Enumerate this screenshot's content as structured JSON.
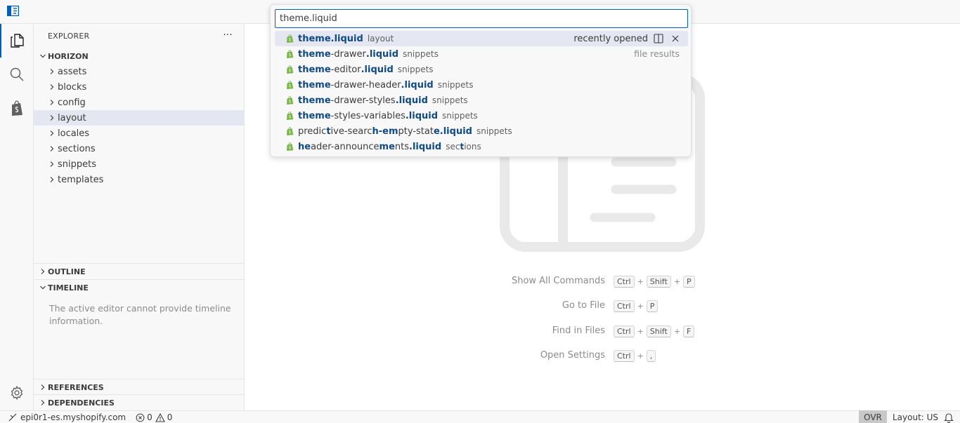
{
  "explorer": {
    "title": "EXPLORER",
    "more_label": "···",
    "workspace": "HORIZON",
    "folders": [
      "assets",
      "blocks",
      "config",
      "layout",
      "locales",
      "sections",
      "snippets",
      "templates"
    ],
    "selected_folder": "layout"
  },
  "panels": {
    "outline": "OUTLINE",
    "timeline": "TIMELINE",
    "timeline_message": "The active editor cannot provide timeline information.",
    "references": "REFERENCES",
    "dependencies": "DEPENDENCIES"
  },
  "quick_open": {
    "query": "theme.liquid",
    "recently_opened_label": "recently opened",
    "file_results_label": "file results",
    "results": [
      {
        "name_parts": [
          {
            "t": "theme.liquid",
            "h": true
          }
        ],
        "desc_parts": [
          {
            "t": "layout",
            "h": false
          }
        ]
      },
      {
        "name_parts": [
          {
            "t": "theme",
            "h": true
          },
          {
            "t": "-drawer",
            "h": false
          },
          {
            "t": ".liquid",
            "h": true
          }
        ],
        "desc_parts": [
          {
            "t": "snippets",
            "h": false
          }
        ]
      },
      {
        "name_parts": [
          {
            "t": "theme",
            "h": true
          },
          {
            "t": "-editor",
            "h": false
          },
          {
            "t": ".liquid",
            "h": true
          }
        ],
        "desc_parts": [
          {
            "t": "snippets",
            "h": false
          }
        ]
      },
      {
        "name_parts": [
          {
            "t": "theme",
            "h": true
          },
          {
            "t": "-drawer-header",
            "h": false
          },
          {
            "t": ".liquid",
            "h": true
          }
        ],
        "desc_parts": [
          {
            "t": "snippets",
            "h": false
          }
        ]
      },
      {
        "name_parts": [
          {
            "t": "theme",
            "h": true
          },
          {
            "t": "-drawer-styles",
            "h": false
          },
          {
            "t": ".liquid",
            "h": true
          }
        ],
        "desc_parts": [
          {
            "t": "snippets",
            "h": false
          }
        ]
      },
      {
        "name_parts": [
          {
            "t": "theme",
            "h": true
          },
          {
            "t": "-styles-variables",
            "h": false
          },
          {
            "t": ".liquid",
            "h": true
          }
        ],
        "desc_parts": [
          {
            "t": "snippets",
            "h": false
          }
        ]
      },
      {
        "name_parts": [
          {
            "t": "predic",
            "h": false
          },
          {
            "t": "t",
            "h": true
          },
          {
            "t": "ive-searc",
            "h": false
          },
          {
            "t": "h-em",
            "h": true
          },
          {
            "t": "pty-stat",
            "h": false
          },
          {
            "t": "e.liquid",
            "h": true
          }
        ],
        "desc_parts": [
          {
            "t": "snippets",
            "h": false
          }
        ]
      },
      {
        "name_parts": [
          {
            "t": "he",
            "h": true
          },
          {
            "t": "ader-announce",
            "h": false
          },
          {
            "t": "me",
            "h": true
          },
          {
            "t": "nts",
            "h": false
          },
          {
            "t": ".liquid",
            "h": true
          }
        ],
        "desc_parts": [
          {
            "t": "sec",
            "h": false
          },
          {
            "t": "t",
            "h": true
          },
          {
            "t": "ions",
            "h": false
          }
        ]
      }
    ]
  },
  "shortcuts": [
    {
      "label": "Show All Commands",
      "keys": [
        "Ctrl",
        "Shift",
        "P"
      ]
    },
    {
      "label": "Go to File",
      "keys": [
        "Ctrl",
        "P"
      ]
    },
    {
      "label": "Find in Files",
      "keys": [
        "Ctrl",
        "Shift",
        "F"
      ]
    },
    {
      "label": "Open Settings",
      "keys": [
        "Ctrl",
        ","
      ]
    }
  ],
  "key_separator": "+",
  "statusbar": {
    "remote": "epi0r1-es.myshopify.com",
    "errors": "0",
    "warnings": "0",
    "mode": "OVR",
    "layout": "Layout: US"
  },
  "icons": {
    "app": "vscode-layout-icon",
    "explorer": "files-icon",
    "search": "search-icon",
    "shopify": "shopify-bag-icon",
    "settings": "gear-icon",
    "file": "shopify-liquid-file-icon",
    "split": "split-editor-icon",
    "close": "close-icon",
    "remote": "remote-icon",
    "error": "error-icon",
    "warning": "warning-icon",
    "bell": "bell-icon"
  },
  "colors": {
    "accent": "#005fb8",
    "highlight": "#0f4a85",
    "liquid_icon": "#7ab648",
    "selection": "#e4e6f1"
  }
}
